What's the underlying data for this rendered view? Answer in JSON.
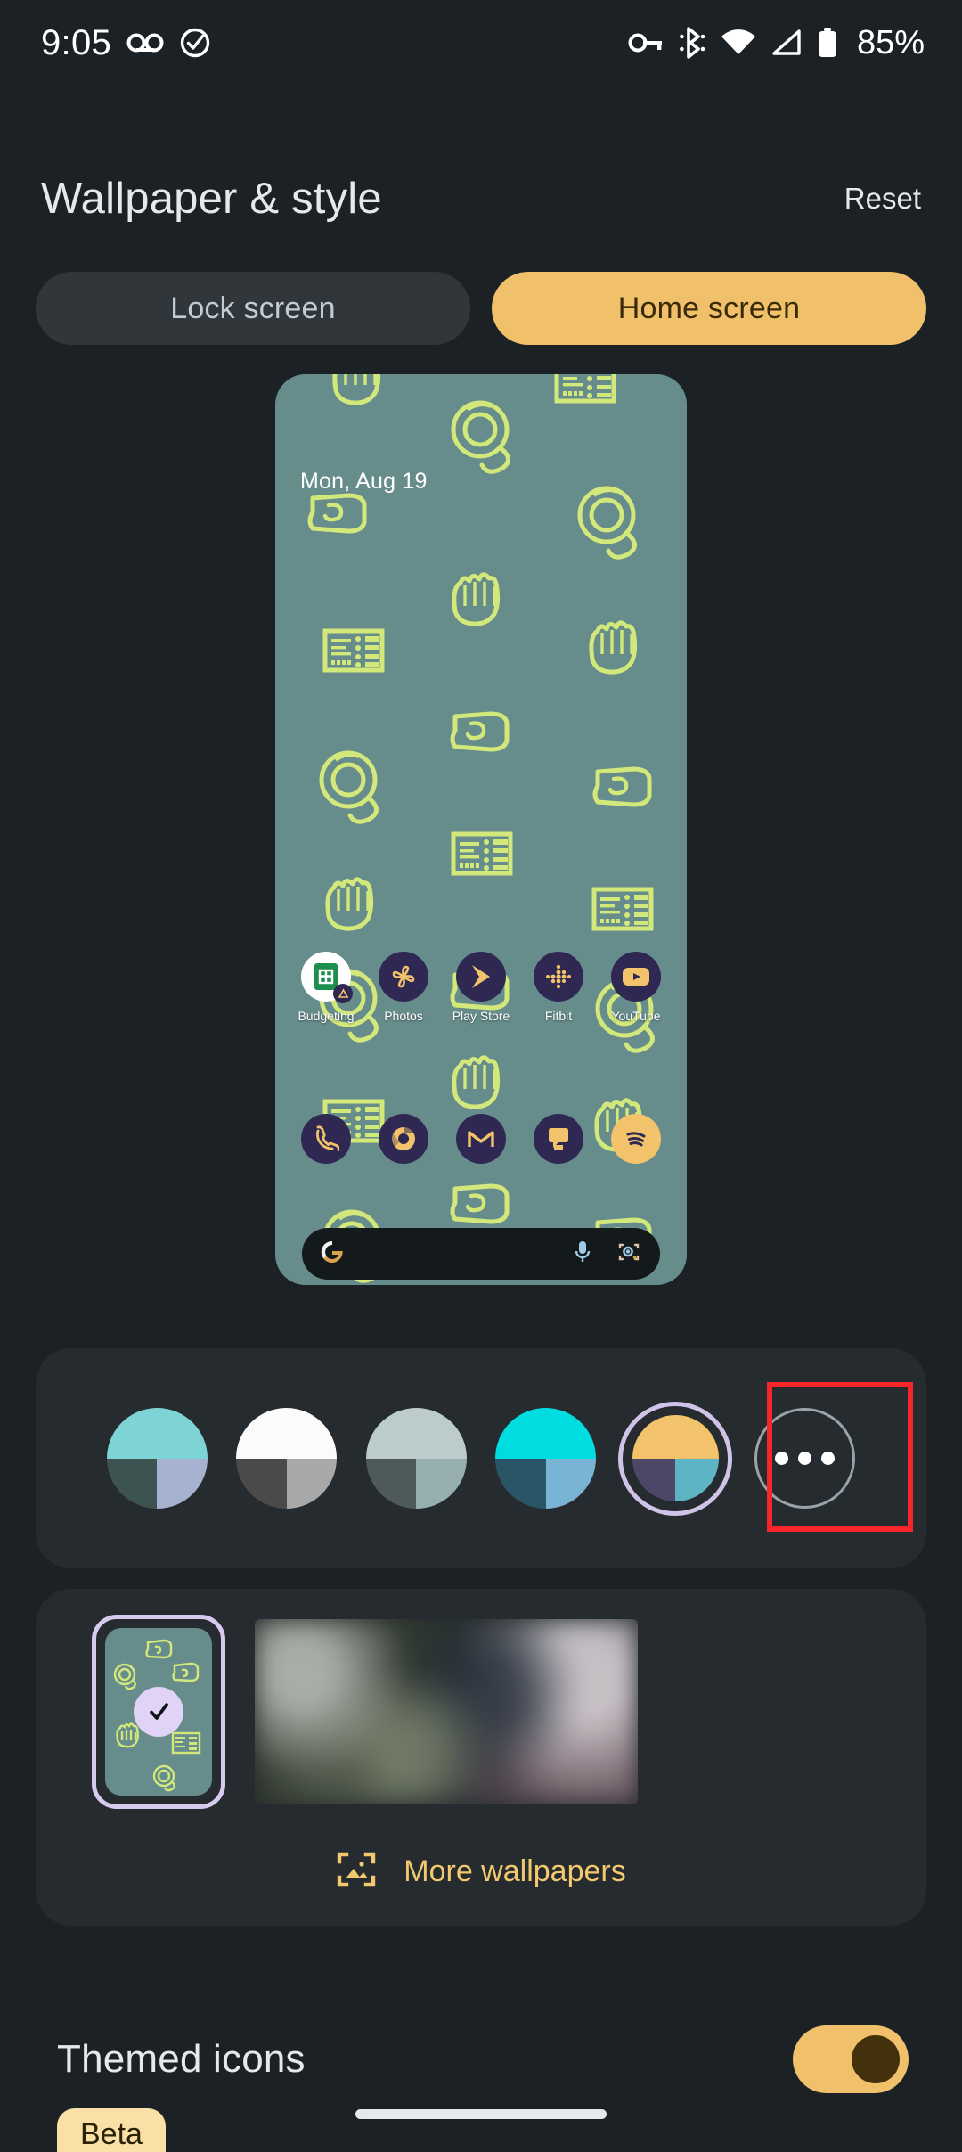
{
  "status_bar": {
    "time": "9:05",
    "battery_percent": "85%",
    "left_icons": [
      "voicemail-icon",
      "check-circle-icon"
    ],
    "right_icons": [
      "vpn-key-icon",
      "bluetooth-icon",
      "wifi-icon",
      "cellular-signal-icon",
      "battery-icon"
    ]
  },
  "header": {
    "title": "Wallpaper & style",
    "reset_label": "Reset"
  },
  "tabs": [
    {
      "label": "Lock screen",
      "active": false
    },
    {
      "label": "Home screen",
      "active": true
    }
  ],
  "preview": {
    "date_text": "Mon, Aug 19",
    "wallpaper_bg": "#678c8c",
    "doodle_color": "#d3e87a",
    "apps_row": [
      {
        "label": "Budgeting",
        "icon": "sheets-icon"
      },
      {
        "label": "Photos",
        "icon": "photos-icon"
      },
      {
        "label": "Play Store",
        "icon": "play-store-icon"
      },
      {
        "label": "Fitbit",
        "icon": "fitbit-icon"
      },
      {
        "label": "YouTube",
        "icon": "youtube-icon"
      }
    ],
    "dock_row": [
      {
        "label": "Phone",
        "icon": "phone-icon"
      },
      {
        "label": "Chrome",
        "icon": "chrome-icon"
      },
      {
        "label": "Gmail",
        "icon": "gmail-icon"
      },
      {
        "label": "Messages",
        "icon": "messages-icon"
      },
      {
        "label": "Spotify",
        "icon": "spotify-icon"
      }
    ],
    "search_bar": {
      "logo": "google-g-icon",
      "mic": "microphone-icon",
      "lens": "google-lens-icon"
    }
  },
  "colors": {
    "swatches": [
      {
        "name": "teal-periwinkle",
        "top": "#7ed4d4",
        "bottom_left": "#3d5352",
        "bottom_right": "#a6b2d0",
        "selected": false
      },
      {
        "name": "monochrome-white",
        "top": "#fbfbfb",
        "bottom_left": "#4a4a4a",
        "bottom_right": "#a8a8a8",
        "selected": false
      },
      {
        "name": "sage-grey",
        "top": "#bccccd",
        "bottom_left": "#4e5a5a",
        "bottom_right": "#97aeae",
        "selected": false
      },
      {
        "name": "cyan-blue",
        "top": "#00dde0",
        "bottom_left": "#2a5566",
        "bottom_right": "#7ab4d4",
        "selected": false
      },
      {
        "name": "amber-purple-teal",
        "top": "#f2c36b",
        "bottom_left": "#4d4666",
        "bottom_right": "#5cb4c4",
        "selected": true
      }
    ],
    "more_button": {
      "name": "more-colors-button",
      "glyph": "three-dots-icon"
    },
    "selection_ring_color": "#cfc3e8",
    "annotation_color": "#f8262b"
  },
  "wallpapers": {
    "selected_thumb": {
      "name": "doodle-wallpaper-thumb",
      "checked": true,
      "check_color": "#e0d3f5"
    },
    "photo_thumb": {
      "name": "photo-wallpaper-thumb",
      "checked": false
    },
    "more_wallpapers": {
      "label": "More wallpapers",
      "icon": "image-frame-icon",
      "color": "#f2c96e"
    }
  },
  "themed_icons": {
    "label": "Themed icons",
    "toggle_on": true,
    "toggle_track_color": "#f0c06a",
    "toggle_knob_color": "#42310a",
    "beta_badge": "Beta"
  },
  "nav": {
    "home_indicator": "home-gesture-bar"
  }
}
